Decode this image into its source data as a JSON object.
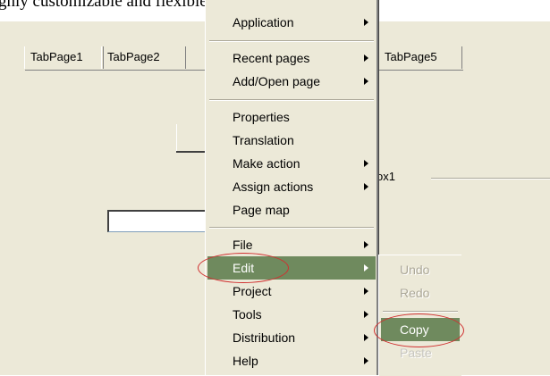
{
  "top_fragment": "ghly customizable and flexible context menu you",
  "tabs": [
    {
      "label": "TabPage1"
    },
    {
      "label": "TabPage2"
    },
    {
      "label": "TabPage5"
    }
  ],
  "groupbox": {
    "label": "ox1"
  },
  "menu": {
    "items": [
      {
        "label": "Application",
        "submenu": true
      },
      {
        "label": "Recent pages",
        "submenu": true
      },
      {
        "label": "Add/Open page",
        "submenu": true
      },
      {
        "label": "Properties",
        "submenu": false
      },
      {
        "label": "Translation",
        "submenu": false
      },
      {
        "label": "Make action",
        "submenu": true
      },
      {
        "label": "Assign actions",
        "submenu": true
      },
      {
        "label": "Page map",
        "submenu": false
      },
      {
        "label": "File",
        "submenu": true
      },
      {
        "label": "Edit",
        "submenu": true,
        "highlighted": true
      },
      {
        "label": "Project",
        "submenu": true
      },
      {
        "label": "Tools",
        "submenu": true
      },
      {
        "label": "Distribution",
        "submenu": true
      },
      {
        "label": "Help",
        "submenu": true
      }
    ]
  },
  "edit_submenu": {
    "items": [
      {
        "label": "Undo",
        "enabled": false
      },
      {
        "label": "Redo",
        "enabled": false
      },
      {
        "label": "Copy",
        "enabled": true,
        "highlighted": true
      },
      {
        "label": "Paste",
        "enabled": false
      }
    ]
  },
  "colors": {
    "highlight": "#6f8a5e",
    "window_bg": "#ece9d8",
    "annotation": "#d03030"
  }
}
